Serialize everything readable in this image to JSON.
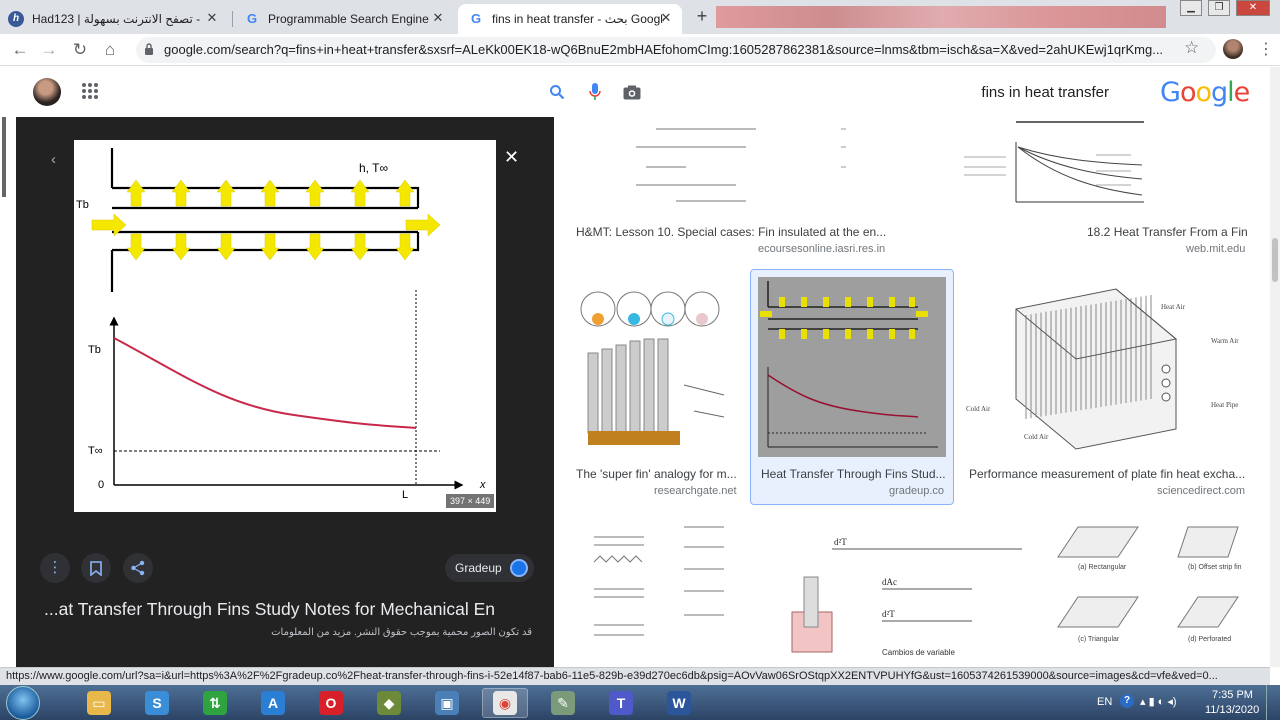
{
  "tabs": [
    {
      "title": "Had123 | يبية - تصفح الانترنت بسهولة",
      "active": false
    },
    {
      "title": "Programmable Search Engine",
      "active": false
    },
    {
      "title": "fins in heat transfer - بحث Google",
      "active": true
    }
  ],
  "window_controls": {
    "minimize": "▁",
    "restore": "❐",
    "close": "✕"
  },
  "address": {
    "url": "google.com/search?q=fins+in+heat+transfer&sxsrf=ALeKk00EK18-wQ6BnuE2mbHAEfohomCImg:1605287862381&source=lnms&tbm=isch&sa=X&ved=2ahUKEwj1qrKmg..."
  },
  "search": {
    "query": "fins in heat transfer"
  },
  "google_logo": {
    "letters": [
      "G",
      "o",
      "o",
      "g",
      "l",
      "e"
    ],
    "colors": [
      "#4285f4",
      "#ea4335",
      "#fbbc05",
      "#4285f4",
      "#34a853",
      "#ea4335"
    ]
  },
  "preview": {
    "diagram": {
      "label_h": "h, T∞",
      "label_tb_top": "Tb",
      "label_tb_axis": "Tb",
      "label_tinf_axis": "T∞",
      "label_zero": "0",
      "label_x": "x",
      "label_L": "L"
    },
    "dimensions": "397 × 449",
    "source_name": "Gradeup",
    "title": "...at Transfer Through Fins Study Notes for Mechanical En",
    "copyright_note": "قد تكون الصور محمية بموجب حقوق النشر. مزيد من المعلومات"
  },
  "results": [
    {
      "caption": "H&MT: Lesson 10. Special cases: Fin insulated at the en...",
      "source": "ecoursesonline.iasri.res.in"
    },
    {
      "caption": "18.2 Heat Transfer From a Fin",
      "source": "web.mit.edu"
    },
    {
      "caption": "The 'super fin' analogy for m...",
      "source": "researchgate.net"
    },
    {
      "caption": "Heat Transfer Through Fins Stud...",
      "source": "gradeup.co"
    },
    {
      "caption": "Performance measurement of plate fin heat excha...",
      "source": "sciencedirect.com"
    }
  ],
  "result_labels": {
    "heat_air": "Heat Air",
    "warm_air": "Warm Air",
    "heat_pipe": "Heat Pipe",
    "cold_air_1": "Cold Air",
    "cold_air_2": "Cold Air",
    "rectangular": "(a) Rectangular",
    "offset": "(b) Offset strip fin",
    "triangular": "(c) Triangular",
    "perforated": "(d) Perforated",
    "cambios": "Cambios de variable"
  },
  "status_url": "https://www.google.com/url?sa=i&url=https%3A%2F%2Fgradeup.co%2Fheat-transfer-through-fins-i-52e14f87-bab6-11e5-829b-e39d270ec6db&psig=AOvVaw06SrOStqpXX2ENTVPUHYfG&ust=1605374261539000&source=images&cd=vfe&ved=0...",
  "taskbar": {
    "lang": "EN",
    "time": "7:35 PM",
    "date": "11/13/2020",
    "apps": [
      {
        "name": "file-explorer",
        "color": "#e8b84a",
        "glyph": "▭"
      },
      {
        "name": "skype-like",
        "color": "#3a8ed8",
        "glyph": "S"
      },
      {
        "name": "green-arrows",
        "color": "#2fa33f",
        "glyph": "⇅"
      },
      {
        "name": "a-app",
        "color": "#2a7fd4",
        "glyph": "A"
      },
      {
        "name": "opera",
        "color": "#d8202a",
        "glyph": "O"
      },
      {
        "name": "usb-tool",
        "color": "#6d8a3a",
        "glyph": "◆"
      },
      {
        "name": "monitor-app",
        "color": "#4a7fb8",
        "glyph": "▣"
      },
      {
        "name": "chrome",
        "color": "#e8e8e8",
        "glyph": "◉"
      },
      {
        "name": "brush-app",
        "color": "#7a9a7a",
        "glyph": "✎"
      },
      {
        "name": "teams",
        "color": "#5059c9",
        "glyph": "T"
      },
      {
        "name": "word",
        "color": "#2b579a",
        "glyph": "W"
      }
    ]
  }
}
